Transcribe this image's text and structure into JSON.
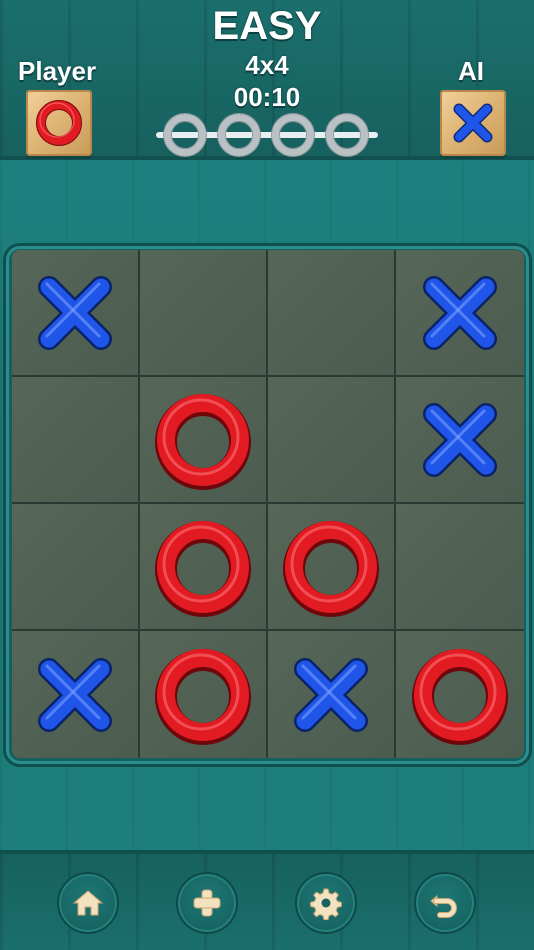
{
  "header": {
    "difficulty": "EASY",
    "board_size": "4x4",
    "timer": "00:10",
    "player_label": "Player",
    "ai_label": "AI",
    "player_token": "O",
    "ai_token": "X",
    "win_rings": 4
  },
  "board": {
    "rows": 4,
    "cols": 4,
    "cells": [
      [
        "X",
        "",
        "",
        "X"
      ],
      [
        "",
        "O",
        "",
        "X"
      ],
      [
        "",
        "O",
        "O",
        ""
      ],
      [
        "X",
        "O",
        "X",
        "O"
      ]
    ]
  },
  "footer": {
    "buttons": [
      {
        "id": "home",
        "icon": "home-icon"
      },
      {
        "id": "add",
        "icon": "plus-icon"
      },
      {
        "id": "settings",
        "icon": "gear-icon"
      },
      {
        "id": "undo",
        "icon": "undo-icon"
      }
    ]
  },
  "colors": {
    "x_blue": "#1f55e8",
    "o_red": "#e21a22",
    "accent_teal": "#1d7d7b"
  }
}
